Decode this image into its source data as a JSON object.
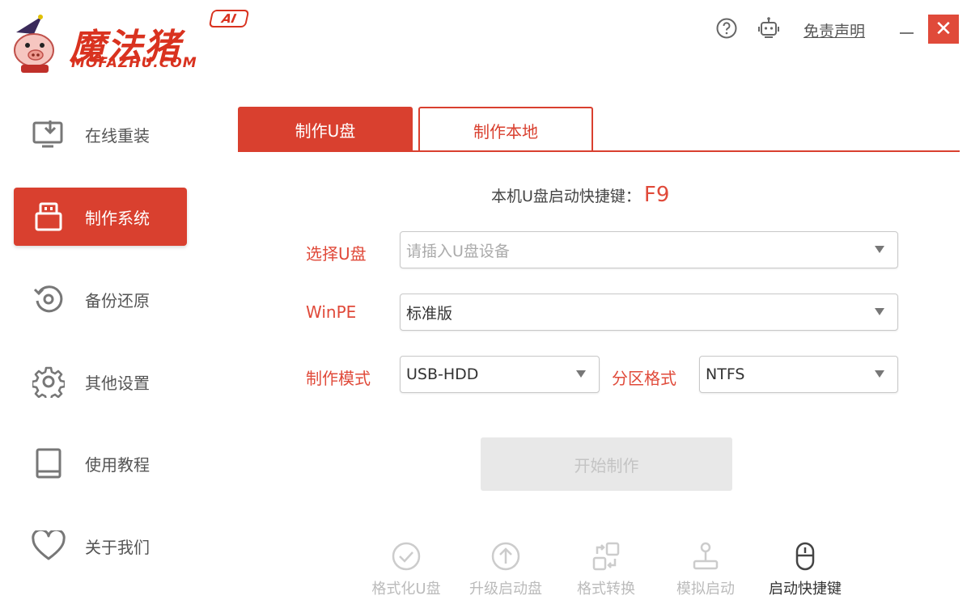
{
  "header": {
    "logo_text": "魔法猪",
    "logo_sub": "MOFAZHU.COM",
    "logo_badge": "AI",
    "disclaimer": "免责声明",
    "close_glyph": "✕",
    "icons": [
      "help-icon",
      "robot-icon",
      "minimize-icon",
      "close-icon"
    ]
  },
  "sidebar": {
    "items": [
      {
        "label": "在线重装",
        "icon": "download-monitor-icon",
        "active": false
      },
      {
        "label": "制作系统",
        "icon": "usb-drive-icon",
        "active": true
      },
      {
        "label": "备份还原",
        "icon": "restore-icon",
        "active": false
      },
      {
        "label": "其他设置",
        "icon": "gear-icon",
        "active": false
      },
      {
        "label": "使用教程",
        "icon": "book-icon",
        "active": false
      },
      {
        "label": "关于我们",
        "icon": "heart-icon",
        "active": false
      }
    ]
  },
  "tabs": [
    {
      "label": "制作U盘",
      "active": true
    },
    {
      "label": "制作本地",
      "active": false
    }
  ],
  "form": {
    "hotkey_label": "本机U盘启动快捷键：",
    "hotkey_value": "F9",
    "usb_label": "选择U盘",
    "usb_placeholder": "请插入U盘设备",
    "winpe_label": "WinPE",
    "winpe_value": "标准版",
    "mode_label": "制作模式",
    "mode_value": "USB-HDD",
    "partition_label": "分区格式",
    "partition_value": "NTFS",
    "start_button": "开始制作"
  },
  "tools": [
    {
      "label": "格式化U盘",
      "icon": "check-circle-icon",
      "enabled": false
    },
    {
      "label": "升级启动盘",
      "icon": "arrow-up-circle-icon",
      "enabled": false
    },
    {
      "label": "格式转换",
      "icon": "convert-icon",
      "enabled": false
    },
    {
      "label": "模拟启动",
      "icon": "joystick-icon",
      "enabled": false
    },
    {
      "label": "启动快捷键",
      "icon": "mouse-icon",
      "enabled": true
    }
  ],
  "colors": {
    "accent": "#d9402f",
    "label_red": "#e04a3a",
    "disabled_bg": "#e8e8e8",
    "disabled_text": "#c4c4c4"
  }
}
